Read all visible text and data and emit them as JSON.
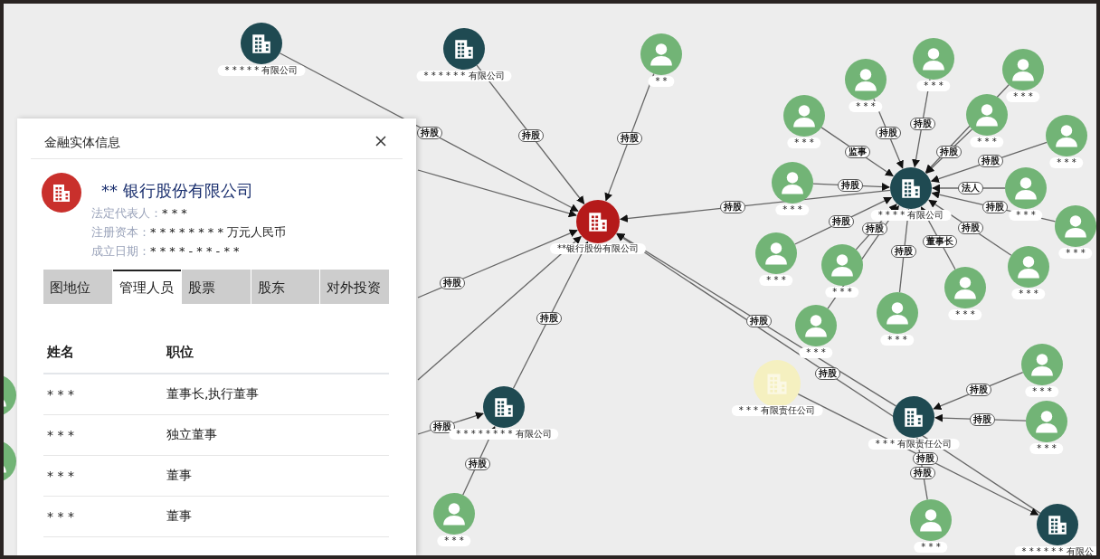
{
  "graph": {
    "nodes": [
      {
        "kind": "company",
        "label": "* * * * *  有限公司"
      },
      {
        "kind": "company",
        "label": "* * * * * * 有限公司"
      },
      {
        "kind": "person",
        "label": "* *"
      },
      {
        "kind": "main",
        "label": "**银行股份有限公司"
      },
      {
        "kind": "company",
        "label": "* * * * 有限公司"
      },
      {
        "kind": "person",
        "label": "* * *"
      },
      {
        "kind": "person",
        "label": "* * *"
      },
      {
        "kind": "person",
        "label": "* * *"
      },
      {
        "kind": "person",
        "label": "* * *"
      },
      {
        "kind": "person",
        "label": "* * *"
      },
      {
        "kind": "person",
        "label": "* * *"
      },
      {
        "kind": "person",
        "label": "* * *"
      },
      {
        "kind": "person",
        "label": "* * *"
      },
      {
        "kind": "person",
        "label": "* * *"
      },
      {
        "kind": "person",
        "label": "* * *"
      },
      {
        "kind": "person",
        "label": "* * *"
      },
      {
        "kind": "person",
        "label": "* * *"
      },
      {
        "kind": "person",
        "label": "* * *"
      },
      {
        "kind": "person",
        "label": "* * *"
      },
      {
        "kind": "person",
        "label": "* * *"
      },
      {
        "kind": "faded",
        "label": "* * * 有限责任公司"
      },
      {
        "kind": "company",
        "label": "* * *     有限责任公司"
      },
      {
        "kind": "person",
        "label": "* * *"
      },
      {
        "kind": "person",
        "label": "* * *"
      },
      {
        "kind": "person",
        "label": "* * *"
      },
      {
        "kind": "company",
        "label": "* * * * * * 有限公"
      },
      {
        "kind": "company",
        "label": "* * * * * * * *  有限公司"
      },
      {
        "kind": "person",
        "label": "* * *"
      },
      {
        "kind": "person"
      },
      {
        "kind": "person"
      }
    ],
    "edges": [
      {
        "kind": "labeled",
        "label": "持股"
      },
      {
        "kind": "labeled",
        "label": "持股"
      },
      {
        "kind": "labeled",
        "label": "持股"
      },
      {
        "kind": "labeled",
        "label": "持股"
      },
      {
        "kind": "line"
      },
      {
        "kind": "labeled",
        "label": "持股"
      },
      {
        "kind": "line"
      },
      {
        "kind": "labeled",
        "label": "持股"
      },
      {
        "kind": "labeled",
        "label": "持股"
      },
      {
        "kind": "labeled",
        "label": "持股"
      },
      {
        "kind": "labeled",
        "label": "持股"
      },
      {
        "kind": "labeled",
        "label": "持股"
      },
      {
        "kind": "labeled",
        "label": "持股"
      },
      {
        "kind": "labeled",
        "label": "持股"
      },
      {
        "kind": "labeled",
        "label": "持股"
      },
      {
        "kind": "labeled",
        "label": "持股"
      },
      {
        "kind": "labeled",
        "label": "持股"
      },
      {
        "kind": "labeled",
        "label": "持股"
      },
      {
        "kind": "line"
      },
      {
        "kind": "labeled",
        "label": "持股"
      },
      {
        "kind": "labeled",
        "label": "监事"
      },
      {
        "kind": "labeled",
        "label": "持股"
      },
      {
        "kind": "labeled",
        "label": "持股"
      },
      {
        "kind": "labeled",
        "label": "法人"
      },
      {
        "kind": "labeled",
        "label": "持股"
      },
      {
        "kind": "labeled",
        "label": "持股"
      },
      {
        "kind": "labeled",
        "label": "持股"
      },
      {
        "kind": "labeled",
        "label": "持股"
      },
      {
        "kind": "labeled",
        "label": "董事长"
      },
      {
        "kind": "labeled",
        "label": "持股"
      },
      {
        "kind": "line"
      }
    ]
  },
  "panel": {
    "title": "金融实体信息",
    "entity": {
      "name": "** 银行股份有限公司",
      "fields": [
        {
          "label": "法定代表人：",
          "value": "* * *"
        },
        {
          "label": "注册资本：",
          "value": "* * * * * * * *  万元人民币"
        },
        {
          "label": "成立日期：",
          "value": "* * * * - * * - * *"
        }
      ]
    },
    "tabs": [
      {
        "label": "图地位",
        "selected": false
      },
      {
        "label": "管理人员",
        "selected": true
      },
      {
        "label": "股票",
        "selected": false
      },
      {
        "label": "股东",
        "selected": false
      },
      {
        "label": "对外投资",
        "selected": false
      }
    ],
    "table": {
      "columns": [
        "姓名",
        "职位"
      ],
      "rows": [
        [
          "* * *",
          "董事长,执行董事"
        ],
        [
          "* * *",
          "独立董事"
        ],
        [
          "* * *",
          "董事"
        ],
        [
          "* * *",
          "董事"
        ]
      ]
    }
  }
}
